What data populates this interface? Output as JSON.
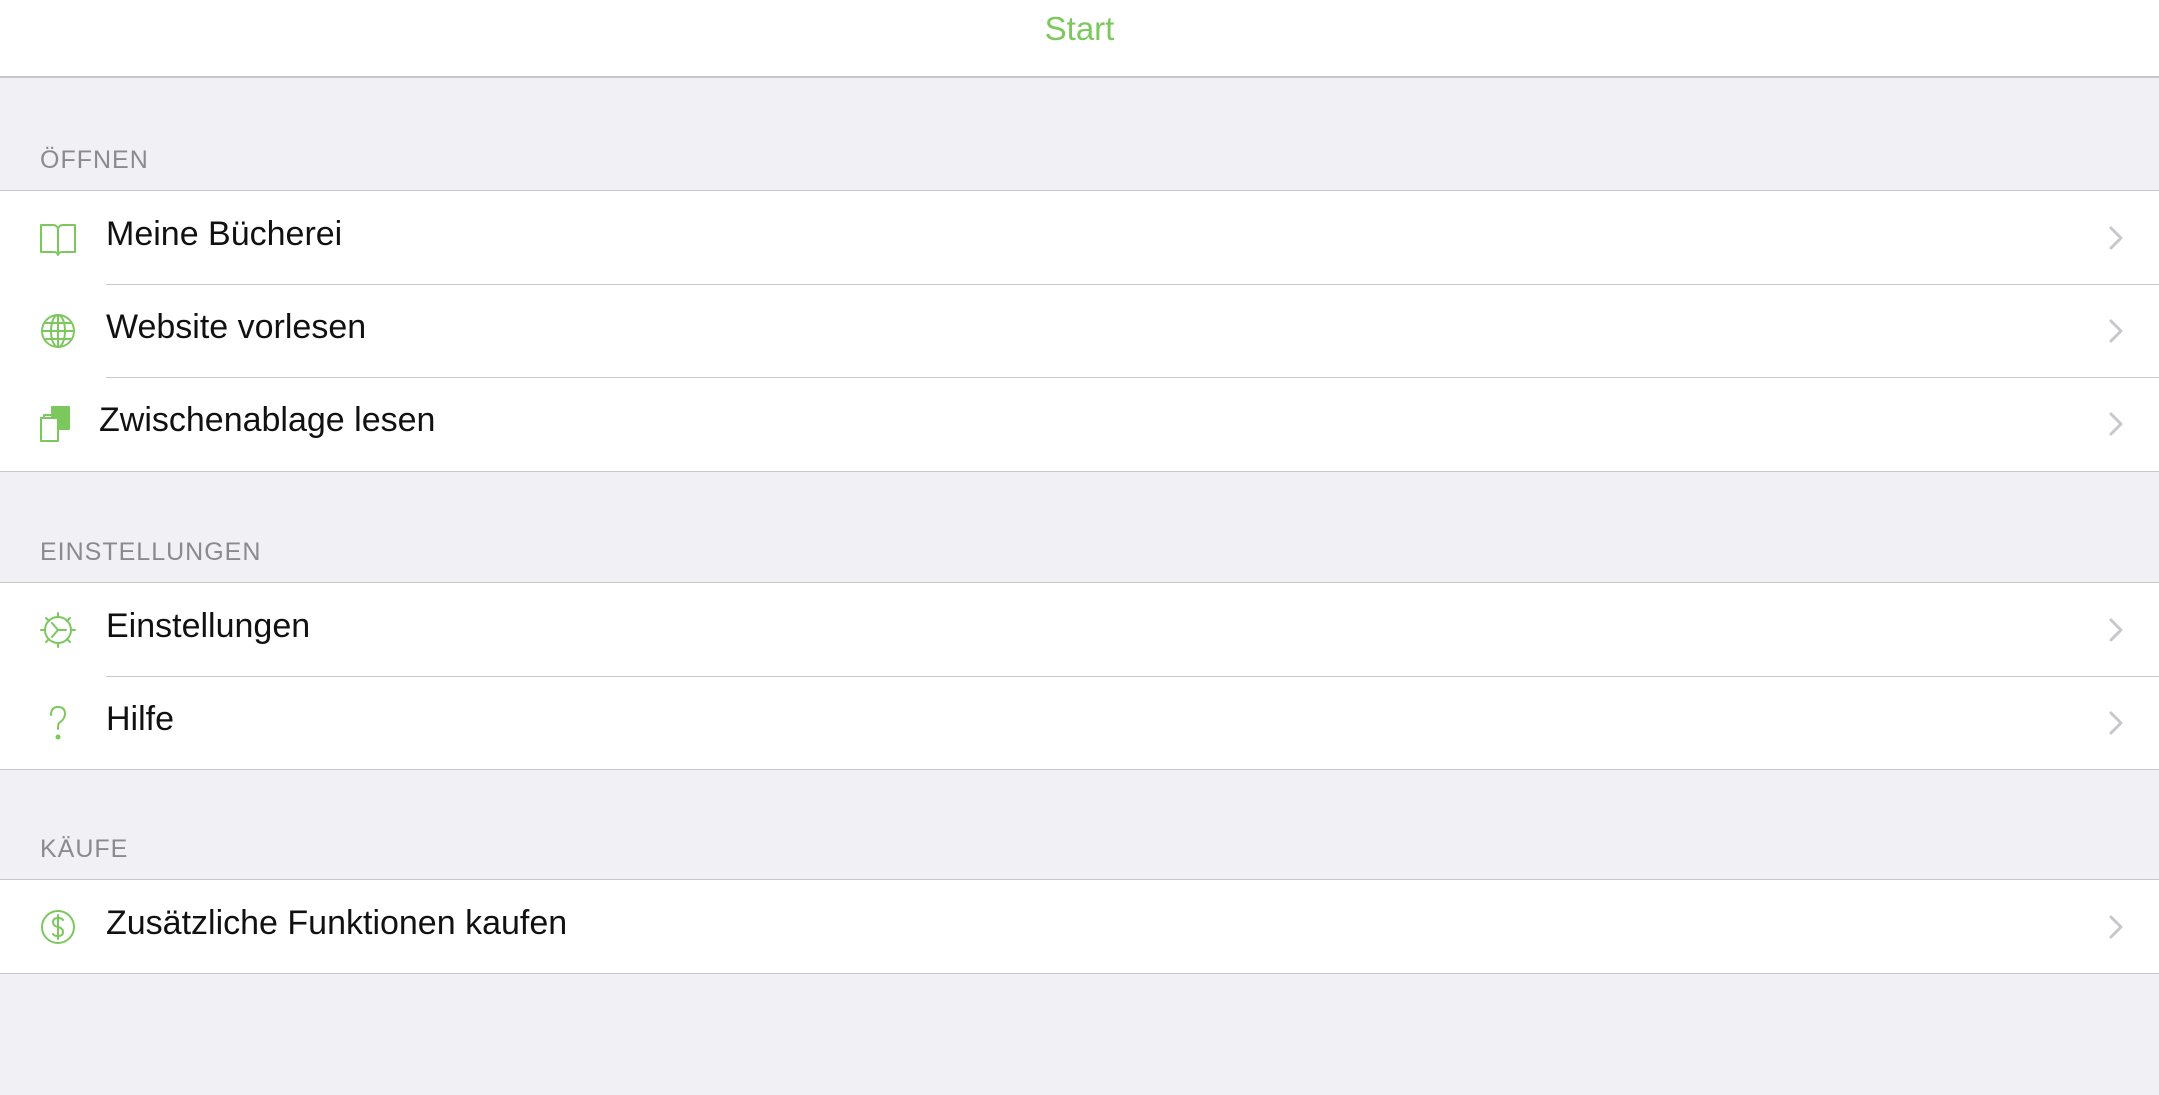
{
  "nav": {
    "title": "Start"
  },
  "sections": {
    "open": {
      "header": "ÖFFNEN",
      "items": [
        {
          "label": "Meine Bücherei",
          "icon": "book-icon"
        },
        {
          "label": "Website vorlesen",
          "icon": "globe-icon"
        },
        {
          "label": "Zwischenablage lesen",
          "icon": "clipboard-icon"
        }
      ]
    },
    "settings": {
      "header": "EINSTELLUNGEN",
      "items": [
        {
          "label": "Einstellungen",
          "icon": "gear-icon"
        },
        {
          "label": "Hilfe",
          "icon": "question-mark-icon"
        }
      ]
    },
    "purchases": {
      "header": "KÄUFE",
      "items": [
        {
          "label": "Zusätzliche Funktionen kaufen",
          "icon": "dollar-icon"
        }
      ]
    }
  },
  "colors": {
    "accent": "#7cc85f",
    "background": "#f1f1f5",
    "separator": "#c8c7cc",
    "header_text": "#8a8a8f",
    "chevron": "#c7c7cc"
  }
}
